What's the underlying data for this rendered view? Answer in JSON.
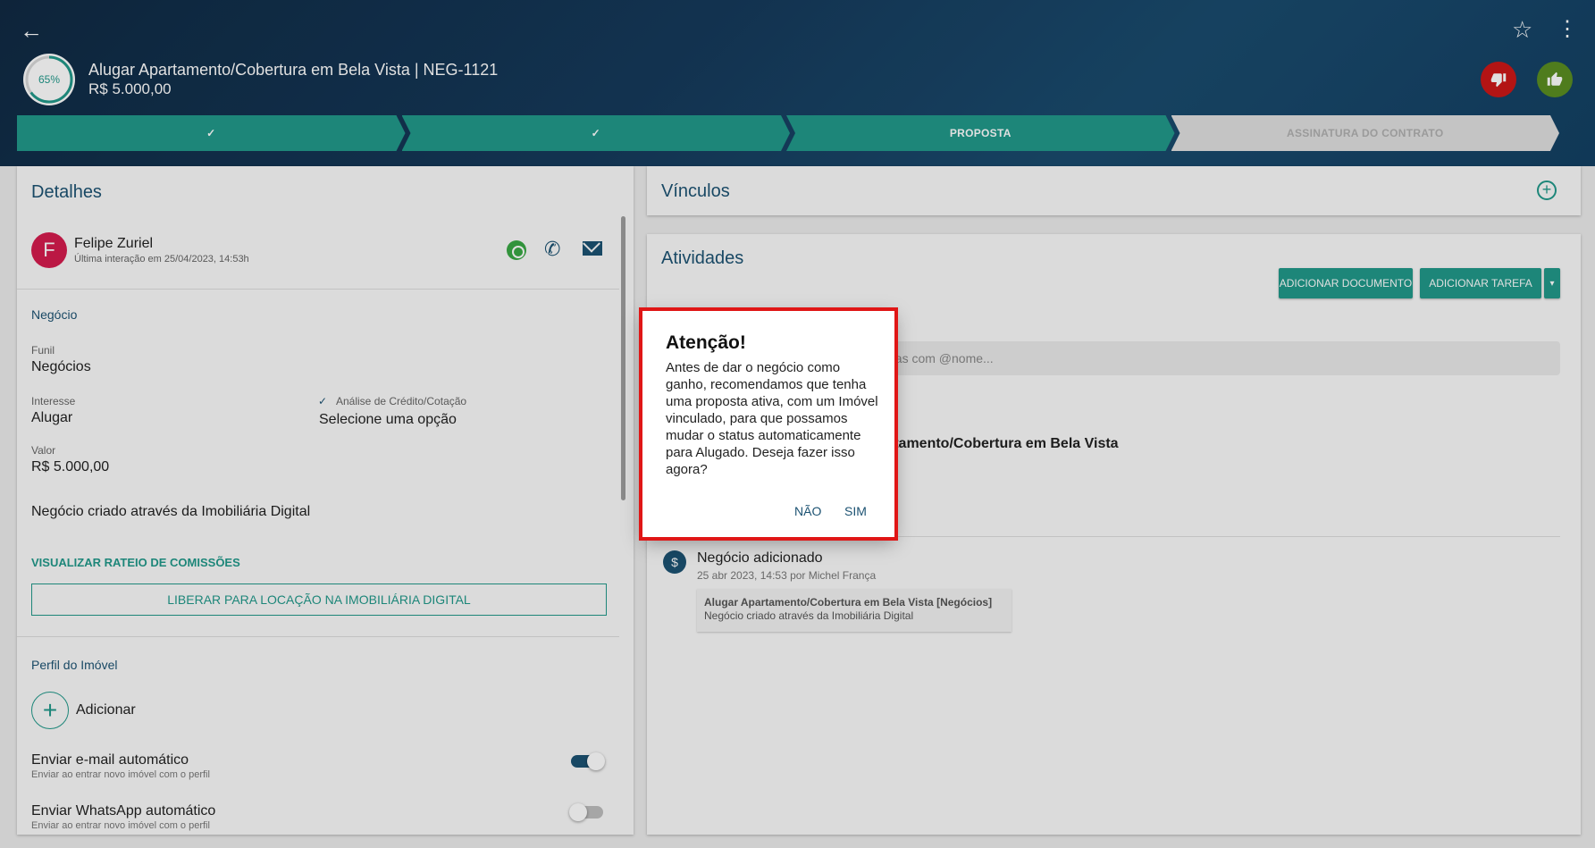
{
  "header": {
    "progress": "65%",
    "progress_value": 0.65,
    "deal_title": "Alugar Apartamento/Cobertura em Bela Vista | NEG-1121",
    "deal_value": "R$ 5.000,00"
  },
  "pipeline": {
    "steps": [
      {
        "label": "✓",
        "status": "done"
      },
      {
        "label": "✓",
        "status": "done"
      },
      {
        "label": "PROPOSTA",
        "status": "current"
      },
      {
        "label": "ASSINATURA DO CONTRATO",
        "status": "todo"
      }
    ]
  },
  "details": {
    "title": "Detalhes",
    "contact": {
      "initial": "F",
      "name": "Felipe Zuriel",
      "last_interaction": "Última interação em 25/04/2023, 14:53h"
    },
    "negocio_label": "Negócio",
    "funil_label": "Funil",
    "funil_value": "Negócios",
    "interesse_label": "Interesse",
    "interesse_value": "Alugar",
    "analise_label": "Análise de Crédito/Cotação",
    "analise_value": "Selecione uma opção",
    "valor_label": "Valor",
    "valor_value": "R$ 5.000,00",
    "origem": "Negócio criado através da Imobiliária Digital",
    "comissoes_link": "VISUALIZAR RATEIO DE COMISSÕES",
    "release_button": "LIBERAR PARA LOCAÇÃO NA IMOBILIÁRIA DIGITAL",
    "perfil_label": "Perfil do Imóvel",
    "adicionar": "Adicionar",
    "email_toggle_title": "Enviar e-mail automático",
    "email_toggle_sub": "Enviar ao entrar novo imóvel com o perfil",
    "whatsapp_toggle_title": "Enviar WhatsApp automático",
    "whatsapp_toggle_sub": "Enviar ao entrar novo imóvel com o perfil"
  },
  "vinculos": {
    "title": "Vínculos"
  },
  "atividades": {
    "title": "Atividades",
    "add_document": "ADICIONAR DOCUMENTO",
    "add_task": "ADICIONAR TAREFA",
    "search_placeholder": "pas com @nome...",
    "partial_heading": "rtamento/Cobertura em Bela Vista",
    "item": {
      "title": "Negócio adicionado",
      "meta": "25 abr 2023, 14:53 por Michel França",
      "box_line1": "Alugar Apartamento/Cobertura em Bela Vista [Negócios]",
      "box_line2": "Negócio criado através da Imobiliária Digital"
    }
  },
  "dialog": {
    "title": "Atenção!",
    "text": "Antes de dar o negócio como ganho, recomendamos que tenha uma proposta ativa, com um Imóvel vinculado, para que possamos mudar o status automaticamente para Alugado. Deseja fazer isso agora?",
    "no": "NÃO",
    "yes": "SIM"
  },
  "colors": {
    "accent": "#21998a",
    "primary": "#1c5272",
    "danger": "#cc1717",
    "success": "#5a8e21",
    "highlight": "#e01616"
  }
}
